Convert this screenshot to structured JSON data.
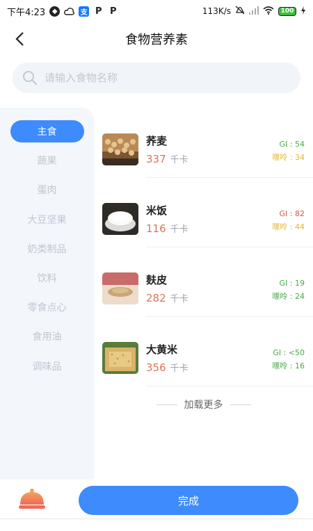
{
  "status_bar": {
    "time": "下午4:23",
    "network_speed": "113K/s",
    "battery": "100"
  },
  "header": {
    "title": "食物营养素"
  },
  "search": {
    "placeholder": "请输入食物名称"
  },
  "categories": [
    {
      "label": "主食",
      "active": true
    },
    {
      "label": "蔬果",
      "active": false
    },
    {
      "label": "蛋肉",
      "active": false
    },
    {
      "label": "大豆坚果",
      "active": false
    },
    {
      "label": "奶类制品",
      "active": false
    },
    {
      "label": "饮料",
      "active": false
    },
    {
      "label": "零食点心",
      "active": false
    },
    {
      "label": "食用油",
      "active": false
    },
    {
      "label": "调味品",
      "active": false
    }
  ],
  "foods": [
    {
      "name": "荞麦",
      "kcal": "337",
      "unit": "千卡",
      "gi": "GI : 54",
      "gi_color": "#4aa84a",
      "purine": "嘌呤 : 34",
      "purine_color": "#e0b92c"
    },
    {
      "name": "米饭",
      "kcal": "116",
      "unit": "千卡",
      "gi": "GI : 82",
      "gi_color": "#d9534f",
      "purine": "嘌呤 : 44",
      "purine_color": "#e0b92c"
    },
    {
      "name": "麸皮",
      "kcal": "282",
      "unit": "千卡",
      "gi": "GI : 19",
      "gi_color": "#4aa84a",
      "purine": "嘌呤 : 24",
      "purine_color": "#4aa84a"
    },
    {
      "name": "大黄米",
      "kcal": "356",
      "unit": "千卡",
      "gi": "GI : <50",
      "gi_color": "#4aa84a",
      "purine": "嘌呤 : 16",
      "purine_color": "#4aa84a"
    }
  ],
  "load_more": "加载更多",
  "bottom": {
    "done_label": "完成"
  },
  "colors": {
    "accent": "#3d8bfd",
    "kcal": "#d8765a"
  }
}
